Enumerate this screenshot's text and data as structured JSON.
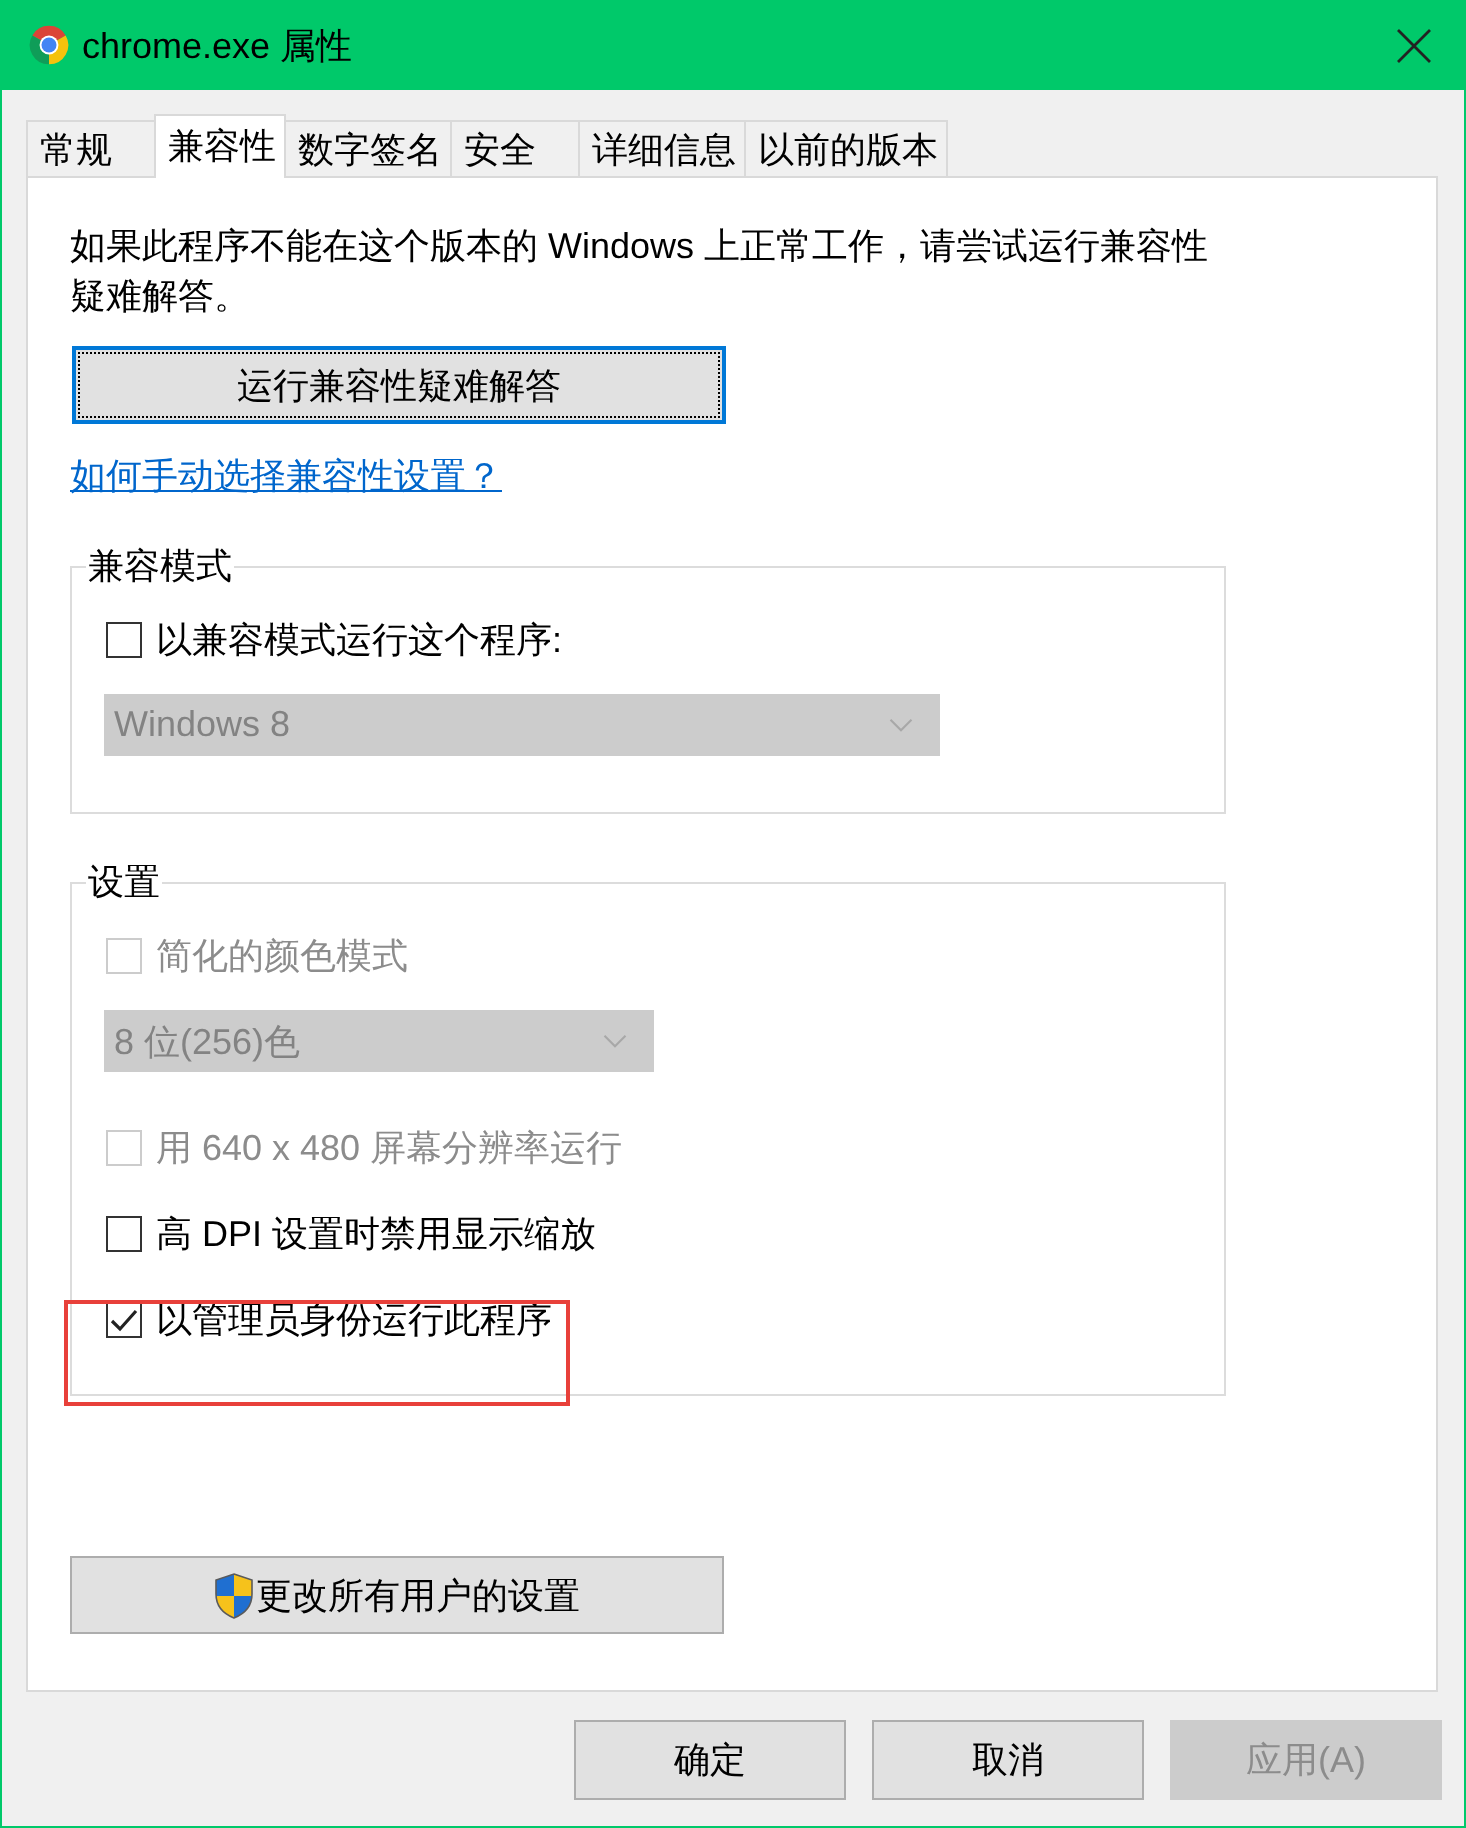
{
  "window": {
    "title": "chrome.exe 属性"
  },
  "tabs": [
    {
      "label": "常规",
      "selected": false
    },
    {
      "label": "兼容性",
      "selected": true
    },
    {
      "label": "数字签名",
      "selected": false
    },
    {
      "label": "安全",
      "selected": false
    },
    {
      "label": "详细信息",
      "selected": false
    },
    {
      "label": "以前的版本",
      "selected": false
    }
  ],
  "compatibility": {
    "intro": "如果此程序不能在这个版本的 Windows 上正常工作，请尝试运行兼容性疑难解答。",
    "troubleshoot_button": {
      "label": "运行兼容性疑难解答",
      "focused": true
    },
    "help_link": "如何手动选择兼容性设置？",
    "compat_mode": {
      "legend": "兼容模式",
      "checkbox": {
        "label": "以兼容模式运行这个程序:",
        "checked": false,
        "disabled": false
      },
      "dropdown": {
        "value": "Windows 8",
        "disabled": true
      }
    },
    "settings": {
      "legend": "设置",
      "options": [
        {
          "kind": "checkbox",
          "label": "简化的颜色模式",
          "checked": false,
          "disabled": true,
          "highlighted": false
        },
        {
          "kind": "dropdown",
          "value": "8 位(256)色",
          "disabled": true
        },
        {
          "kind": "checkbox",
          "label": "用 640 x 480 屏幕分辨率运行",
          "checked": false,
          "disabled": true,
          "highlighted": false
        },
        {
          "kind": "checkbox",
          "label": "高 DPI 设置时禁用显示缩放",
          "checked": false,
          "disabled": false,
          "highlighted": false
        },
        {
          "kind": "checkbox",
          "label": "以管理员身份运行此程序",
          "checked": true,
          "disabled": false,
          "highlighted": true
        }
      ]
    },
    "all_users_button": {
      "label": "更改所有用户的设置"
    }
  },
  "buttons": [
    {
      "label": "确定",
      "disabled": false
    },
    {
      "label": "取消",
      "disabled": false
    },
    {
      "label": "应用(A)",
      "disabled": true
    }
  ]
}
